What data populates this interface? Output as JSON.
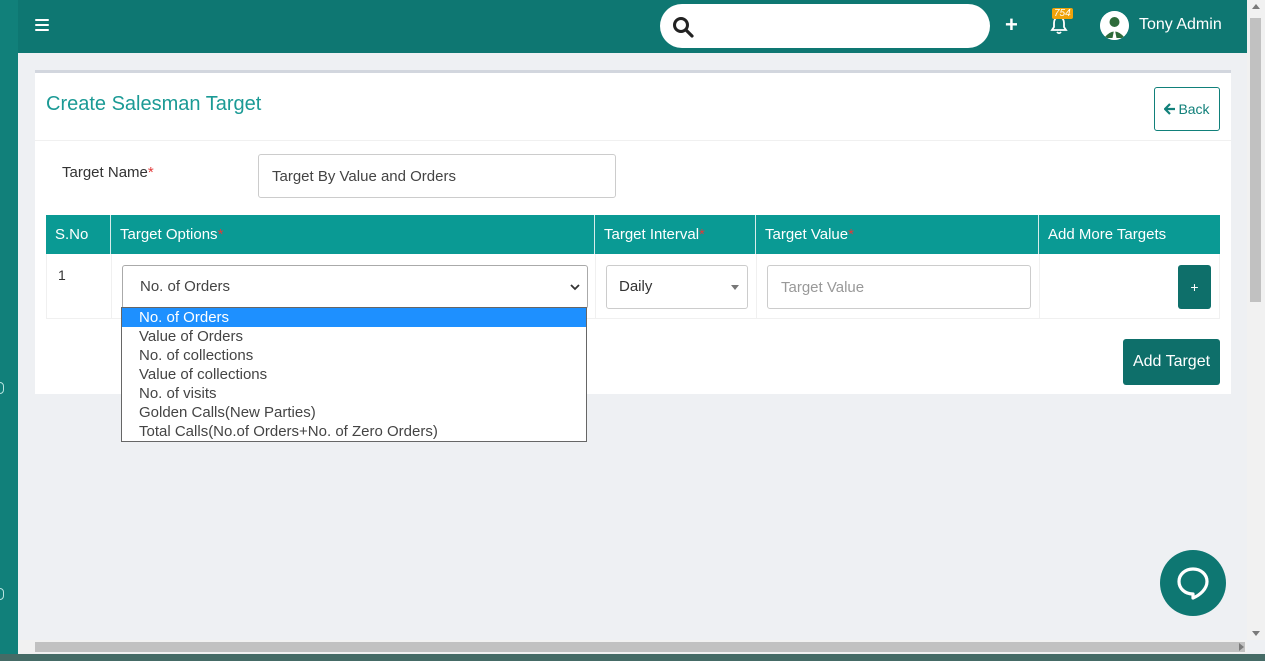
{
  "topbar": {
    "search_placeholder": "",
    "notifications_count": "754",
    "user_name": "Tony Admin"
  },
  "card": {
    "title": "Create Salesman Target",
    "back_label": "Back"
  },
  "form": {
    "target_name_label": "Target Name",
    "required_mark": "*",
    "target_name_value": "Target By Value and Orders"
  },
  "table": {
    "headers": {
      "sno": "S.No",
      "options": "Target Options",
      "interval": "Target Interval",
      "value": "Target Value",
      "add_more": "Add More Targets"
    },
    "rows": [
      {
        "sno": "1",
        "option_selected": "No. of Orders",
        "interval_selected": "Daily",
        "value_placeholder": "Target Value",
        "add_label": "+"
      }
    ]
  },
  "add_target_label": "Add Target",
  "dropdown": {
    "options": [
      "No. of Orders",
      "Value of Orders",
      "No. of collections",
      "Value of collections",
      "No. of visits",
      "Golden Calls(New Parties)",
      "Total Calls(No.of Orders+No. of Zero Orders)"
    ],
    "highlighted_index": 0
  },
  "colors": {
    "primary": "#0e7772",
    "table_header": "#0a9a94",
    "title": "#1b9a95",
    "badge": "#f0a30a",
    "required": "#e23a3a",
    "highlight": "#1e90ff"
  }
}
